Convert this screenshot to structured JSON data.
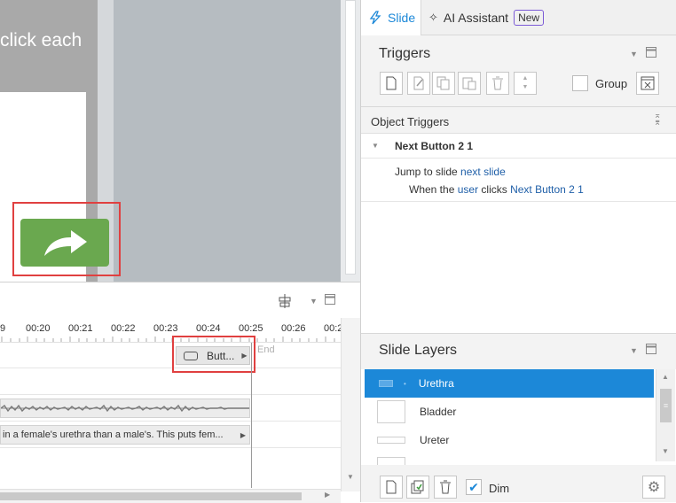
{
  "slide": {
    "text": "click each",
    "next_button_icon": "curved-arrow-right-icon"
  },
  "timeline": {
    "ticks": [
      "9",
      "00:20",
      "00:21",
      "00:22",
      "00:23",
      "00:24",
      "00:25",
      "00:26",
      "00:2"
    ],
    "button_clip_label": "Butt...",
    "end_label": "End",
    "caption_text": "in a female's urethra than a male's. This puts fem..."
  },
  "tabs": {
    "slide": "Slide",
    "ai_assistant": "AI Assistant",
    "new_badge": "New"
  },
  "triggers": {
    "title": "Triggers",
    "group_label": "Group",
    "object_triggers_title": "Object Triggers",
    "object_name": "Next Button 2 1",
    "action_prefix": "Jump to slide",
    "action_target": "next slide",
    "condition_when": "When the",
    "condition_user": "user",
    "condition_clicks": "clicks",
    "condition_object": "Next Button 2 1"
  },
  "layers": {
    "title": "Slide Layers",
    "items": [
      "Urethra",
      "Bladder",
      "Ureter",
      ""
    ],
    "dim_label": "Dim"
  },
  "colors": {
    "accent": "#1c88d8",
    "link": "#1f5fa8",
    "highlight_box": "#e04040",
    "button_green": "#6aa84f"
  }
}
